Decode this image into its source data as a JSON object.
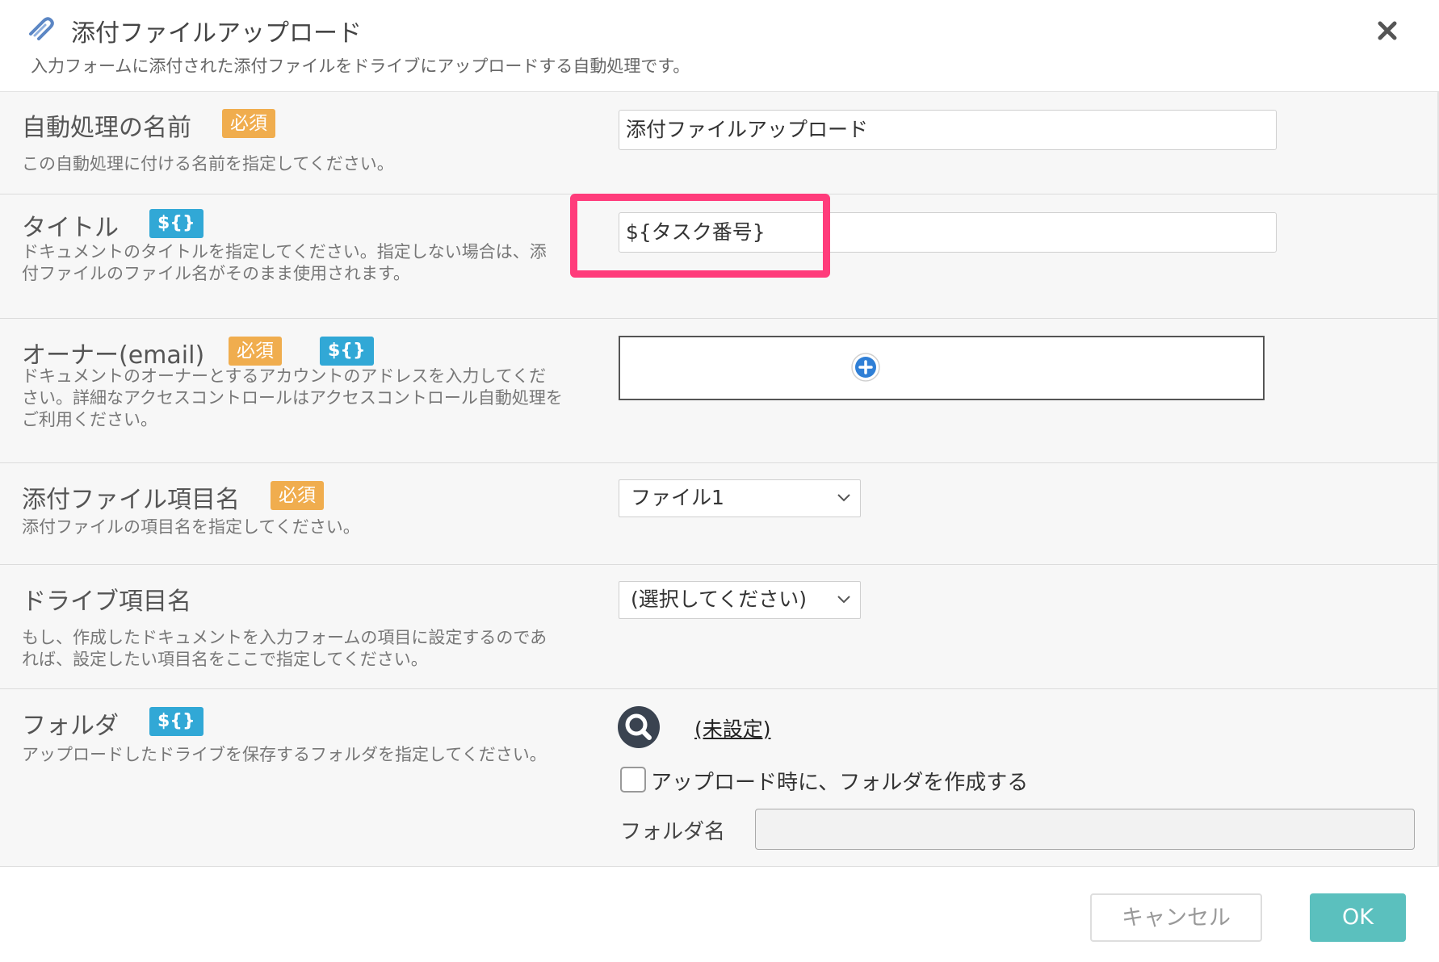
{
  "header": {
    "title": "添付ファイルアップロード",
    "description": "入力フォームに添付された添付ファイルをドライブにアップロードする自動処理です。"
  },
  "badges": {
    "required": "必須",
    "variable": "${}"
  },
  "fields": {
    "name": {
      "label": "自動処理の名前",
      "help": "この自動処理に付ける名前を指定してください。",
      "value": "添付ファイルアップロード"
    },
    "title": {
      "label": "タイトル",
      "help": "ドキュメントのタイトルを指定してください。指定しない場合は、添\n付ファイルのファイル名がそのまま使用されます。",
      "value": "${タスク番号}"
    },
    "owner": {
      "label": "オーナー(email)",
      "help": "ドキュメントのオーナーとするアカウントのアドレスを入力してくだ\nさい。詳細なアクセスコントロールはアクセスコントロール自動処理を\nご利用ください。"
    },
    "attachment": {
      "label": "添付ファイル項目名",
      "help": "添付ファイルの項目名を指定してください。",
      "selected": "ファイル1"
    },
    "drive": {
      "label": "ドライブ項目名",
      "help": "もし、作成したドキュメントを入力フォームの項目に設定するのであ\nれば、設定したい項目名をここで指定してください。",
      "selected": "(選択してください)"
    },
    "folder": {
      "label": "フォルダ",
      "help": "アップロードしたドライブを保存するフォルダを指定してください。",
      "link": "(未設定)",
      "create_checkbox_label": "アップロード時に、フォルダを作成する",
      "create_checked": false,
      "folder_name_label": "フォルダ名",
      "folder_name_value": ""
    }
  },
  "footer": {
    "cancel_label": "キャンセル",
    "ok_label": "OK"
  },
  "colors": {
    "required_badge": "#f0ad4e",
    "variable_badge": "#31a8d6",
    "highlight": "#ff3c7b",
    "ok_button": "#5bc0be",
    "plus_icon": "#2f7fd6"
  }
}
